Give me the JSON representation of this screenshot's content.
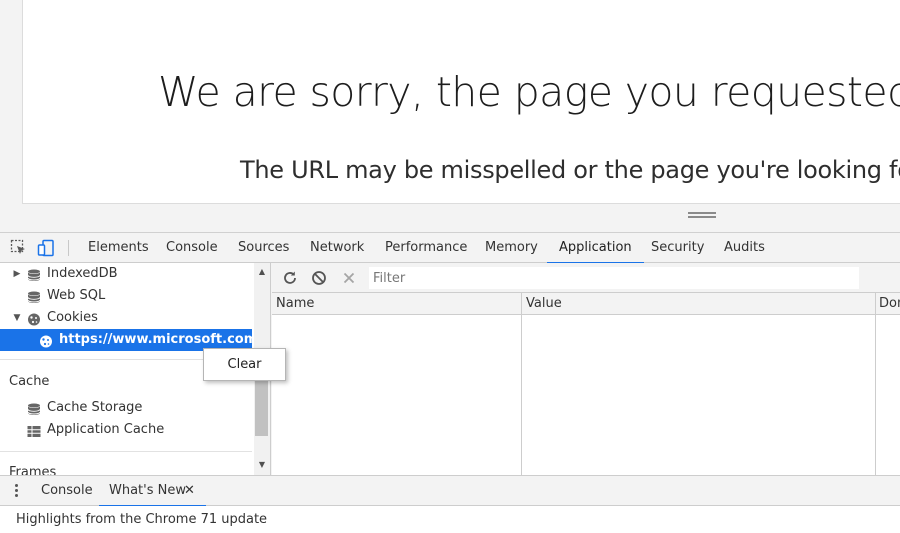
{
  "page": {
    "title": "We are sorry, the page you requested cannot be found.",
    "subtitle": "The URL may be misspelled or the page you're looking for is no longer available."
  },
  "devtools": {
    "tabs": [
      {
        "label": "Elements"
      },
      {
        "label": "Console"
      },
      {
        "label": "Sources"
      },
      {
        "label": "Network"
      },
      {
        "label": "Performance"
      },
      {
        "label": "Memory"
      },
      {
        "label": "Application",
        "active": true
      },
      {
        "label": "Security"
      },
      {
        "label": "Audits"
      }
    ],
    "icons": {
      "inspect": "inspect-element-icon",
      "device": "device-toolbar-icon"
    }
  },
  "sidebar": {
    "items": [
      {
        "label": "IndexedDB",
        "icon": "database-icon",
        "expander": "▶"
      },
      {
        "label": "Web SQL",
        "icon": "database-icon"
      },
      {
        "label": "Cookies",
        "icon": "cookie-icon",
        "expander": "▼"
      },
      {
        "label": "https://www.microsoft.com",
        "icon": "cookie-icon",
        "selected": true
      }
    ],
    "cache_section": "Cache",
    "cache_items": [
      {
        "label": "Cache Storage",
        "icon": "database-icon"
      },
      {
        "label": "Application Cache",
        "icon": "grid-icon"
      }
    ],
    "frames_section": "Frames"
  },
  "context_menu": {
    "clear_label": "Clear"
  },
  "cookie_panel": {
    "toolbar_icons": [
      "refresh-icon",
      "clear-all-icon",
      "delete-selected-icon"
    ],
    "filter_placeholder": "Filter",
    "columns": [
      "Name",
      "Value",
      "Domain"
    ]
  },
  "drawer": {
    "tabs": [
      {
        "label": "Console"
      },
      {
        "label": "What's New",
        "active": true,
        "closable": true
      }
    ],
    "message": "Highlights from the Chrome 71 update"
  },
  "colors": {
    "accent": "#1a73e8",
    "selected_bg": "#1a73e8",
    "panel_bg": "#f3f3f3"
  }
}
